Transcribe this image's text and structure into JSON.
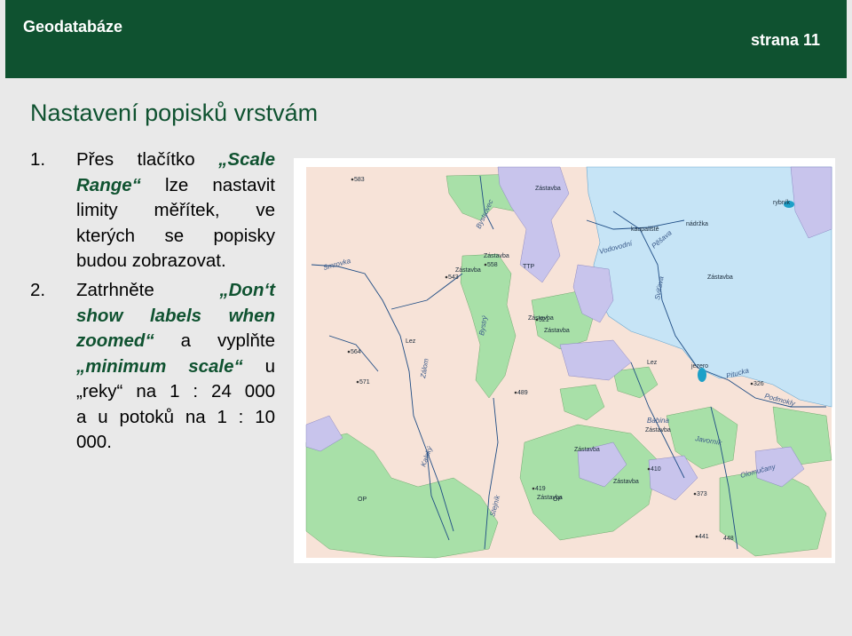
{
  "header": {
    "brand": "Geodatabáze",
    "page": "strana 11"
  },
  "title": "Nastavení popisků vrstvám",
  "item1": {
    "num": "1.",
    "l1a": "Přes tlačítko ",
    "l1b": "„Scale",
    "l2a": "Range“",
    "l2b": " lze nastavit",
    "l3": "limity měřítek, ve",
    "l4": "kterých se popisky",
    "l5": "budou zobrazovat."
  },
  "item2": {
    "num": "2.",
    "l1a": "Zatrhněte ",
    "l1b": "„Don‘t",
    "l2": "show labels when",
    "l3a": "zoomed“",
    "l3b": " a vyplňte",
    "l4a": "„minimum scale“",
    "l4b": " u",
    "l5": "„reky“ na 1 : 24 000",
    "l6": "a u potoků na 1 : 10",
    "l7": "000."
  },
  "map": {
    "colors": {
      "water": "#c6e4f6",
      "land": "#f7e3d8",
      "forest": "#a8e0a8",
      "meadow": "#c8c4ec",
      "river": "#1e4c84",
      "header": "#0f5230"
    },
    "labels": [
      {
        "t": "583"
      },
      {
        "t": "Zástavba"
      },
      {
        "t": "Bystrovec"
      },
      {
        "t": "kaupaliště"
      },
      {
        "t": "nádržka"
      },
      {
        "t": "rybník"
      },
      {
        "t": "Vodovodní"
      },
      {
        "t": "Pěšava"
      },
      {
        "t": "Zástavba"
      },
      {
        "t": "Zástavba"
      },
      {
        "t": "558"
      },
      {
        "t": "TTP"
      },
      {
        "t": "543"
      },
      {
        "t": "Sviťava"
      },
      {
        "t": "Smrovka"
      },
      {
        "t": "Zástavba"
      },
      {
        "t": "Bystrý"
      },
      {
        "t": "Zástavba"
      },
      {
        "t": "521"
      },
      {
        "t": "Zástavba"
      },
      {
        "t": "Lez"
      },
      {
        "t": "564"
      },
      {
        "t": "Zálom"
      },
      {
        "t": "571"
      },
      {
        "t": "489"
      },
      {
        "t": "Lez"
      },
      {
        "t": "jezero"
      },
      {
        "t": "Pitucka"
      },
      {
        "t": "326"
      },
      {
        "t": "Podmokly"
      },
      {
        "t": "Babina"
      },
      {
        "t": "Zástavba"
      },
      {
        "t": "Javorník"
      },
      {
        "t": "Kalský"
      },
      {
        "t": "410"
      },
      {
        "t": "Zástavba"
      },
      {
        "t": "Zástavba"
      },
      {
        "t": "419"
      },
      {
        "t": "Zástavba"
      },
      {
        "t": "Olomučany"
      },
      {
        "t": "373"
      },
      {
        "t": "Stejník"
      },
      {
        "t": "441"
      },
      {
        "t": "448"
      },
      {
        "t": "OP"
      },
      {
        "t": "OP"
      }
    ]
  }
}
